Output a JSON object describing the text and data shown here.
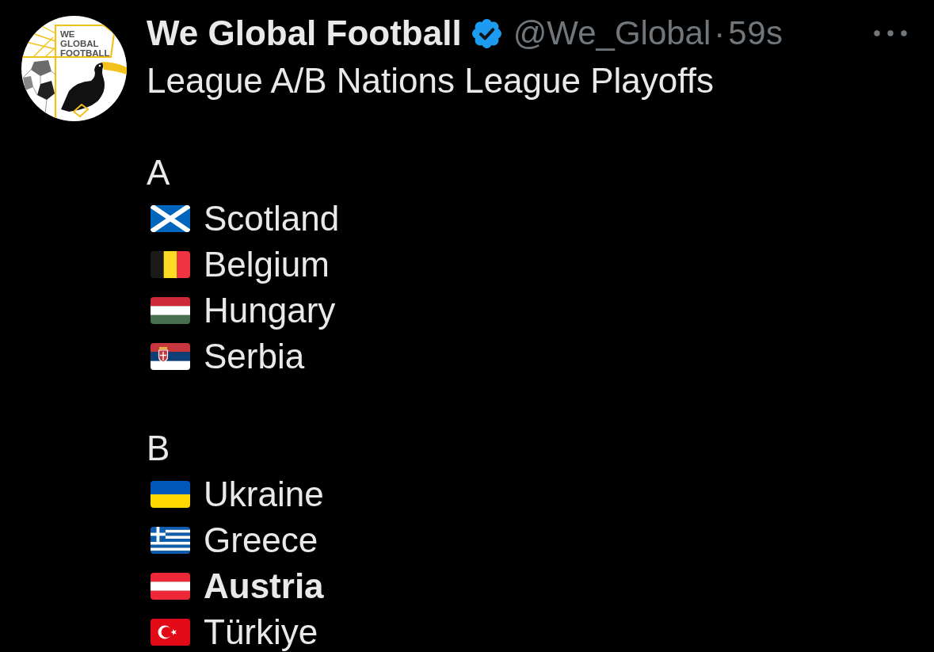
{
  "avatar": {
    "logo_text": [
      "WE",
      "GLOBAL",
      "FOOTBALL"
    ]
  },
  "author": {
    "name": "We Global Football",
    "verified": true,
    "handle": "@We_Global",
    "separator": "·",
    "time": "59s"
  },
  "post": {
    "text": "League A/B Nations League Playoffs",
    "groups": [
      {
        "label": "A",
        "teams": [
          {
            "kind": "saltire",
            "name": "Scotland",
            "emphasized": false
          },
          {
            "kind": "vtricolor",
            "name": "Belgium",
            "emphasized": false
          },
          {
            "kind": "htricolor",
            "name": "Hungary",
            "emphasized": false
          },
          {
            "kind": "crested",
            "name": "Serbia",
            "emphasized": false
          }
        ]
      },
      {
        "label": "B",
        "teams": [
          {
            "kind": "bicolor",
            "name": "Ukraine",
            "emphasized": false
          },
          {
            "kind": "striped",
            "name": "Greece",
            "emphasized": false
          },
          {
            "kind": "triband",
            "name": "Austria",
            "emphasized": true
          },
          {
            "kind": "crescent",
            "name": "Türkiye",
            "emphasized": false
          }
        ]
      }
    ]
  }
}
